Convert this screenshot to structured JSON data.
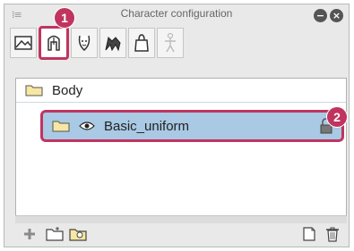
{
  "window": {
    "title": "Character configuration",
    "minimize_label": "−",
    "close_label": "×"
  },
  "toolbar": {
    "tabs": [
      {
        "icon": "landscape-icon"
      },
      {
        "icon": "hair-icon"
      },
      {
        "icon": "face-icon"
      },
      {
        "icon": "clothing-animal-icon"
      },
      {
        "icon": "bag-icon"
      },
      {
        "icon": "body-figure-icon"
      }
    ]
  },
  "callouts": {
    "one": "1",
    "two": "2"
  },
  "tree": {
    "group_label": "Body",
    "item_label": "Basic_uniform"
  },
  "colors": {
    "highlight": "#c0345f",
    "selection": "#a9c9e4"
  }
}
